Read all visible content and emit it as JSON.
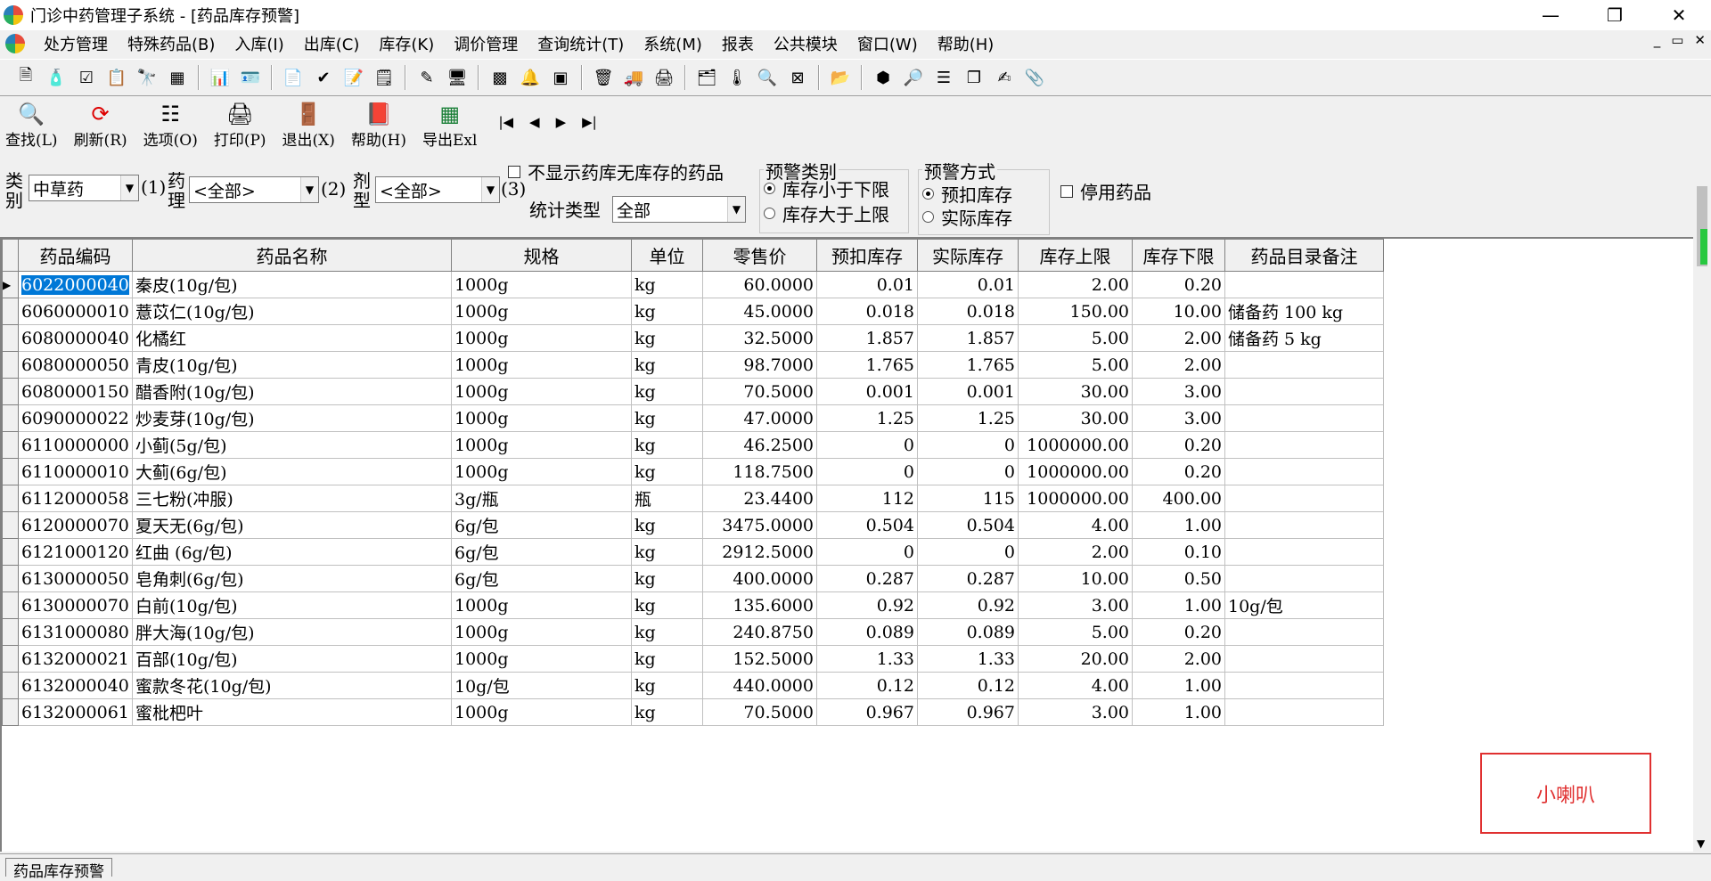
{
  "window": {
    "title": "门诊中药管理子系统 - [药品库存预警]",
    "controls": [
      "—",
      "❐",
      "✕"
    ]
  },
  "menu": [
    "处方管理",
    "特殊药品(B)",
    "入库(I)",
    "出库(C)",
    "库存(K)",
    "调价管理",
    "查询统计(T)",
    "系统(M)",
    "报表",
    "公共模块",
    "窗口(W)",
    "帮助(H)"
  ],
  "mdi_controls": [
    "_",
    "▭",
    "✕"
  ],
  "toolbar_icons": [
    "document-icon",
    "bottle-icon",
    "check-icon",
    "list-icon",
    "binoculars-icon",
    "database-icon",
    "chart-icon",
    "card-icon",
    "clipboard-icon",
    "checklist-icon",
    "edit-icon",
    "edit2-icon",
    "monitor-icon",
    "grid-icon",
    "bell-icon",
    "chip-icon",
    "bin-icon",
    "truck-icon",
    "print-icon",
    "folder-icon",
    "thermo-icon",
    "zoom-icon",
    "calc-icon",
    "open-folder-icon",
    "hexagon-icon",
    "search-icon",
    "table-icon",
    "windows-icon",
    "pen-icon",
    "clip-icon"
  ],
  "actions": {
    "find": "查找(L)",
    "refresh": "刷新(R)",
    "options": "选项(O)",
    "print": "打印(P)",
    "exit": "退出(X)",
    "help": "帮助(H)",
    "export": "导出Exl"
  },
  "nav": [
    "|◀",
    "◀",
    "▶",
    "▶|"
  ],
  "filters": {
    "category_label": "类别",
    "category_value": "中草药",
    "num1": "(1)",
    "pharm_label": "药理",
    "pharm_value": "<全部>",
    "num2": "(2)",
    "form_label": "剂型",
    "form_value": "<全部>",
    "num3": "(3)",
    "hide_empty": "不显示药库无库存的药品",
    "stat_type_label": "统计类型",
    "stat_type_value": "全部",
    "alert_type_title": "预警类别",
    "alert_type_opt1": "库存小于下限",
    "alert_type_opt2": "库存大于上限",
    "alert_mode_title": "预警方式",
    "alert_mode_opt1": "预扣库存",
    "alert_mode_opt2": "实际库存",
    "disabled_drug": "停用药品"
  },
  "table": {
    "headers": [
      "药品编码",
      "药品名称",
      "规格",
      "单位",
      "零售价",
      "预扣库存",
      "实际库存",
      "库存上限",
      "库存下限",
      "药品目录备注"
    ],
    "rows": [
      [
        "6022000040",
        "秦皮(10g/包)",
        "1000g",
        "kg",
        "60.0000",
        "0.01",
        "0.01",
        "2.00",
        "0.20",
        ""
      ],
      [
        "6060000010",
        "薏苡仁(10g/包)",
        "1000g",
        "kg",
        "45.0000",
        "0.018",
        "0.018",
        "150.00",
        "10.00",
        "储备药 100 kg"
      ],
      [
        "6080000040",
        "化橘红",
        "1000g",
        "kg",
        "32.5000",
        "1.857",
        "1.857",
        "5.00",
        "2.00",
        "储备药 5 kg"
      ],
      [
        "6080000050",
        "青皮(10g/包)",
        "1000g",
        "kg",
        "98.7000",
        "1.765",
        "1.765",
        "5.00",
        "2.00",
        ""
      ],
      [
        "6080000150",
        "醋香附(10g/包)",
        "1000g",
        "kg",
        "70.5000",
        "0.001",
        "0.001",
        "30.00",
        "3.00",
        ""
      ],
      [
        "6090000022",
        "炒麦芽(10g/包)",
        "1000g",
        "kg",
        "47.0000",
        "1.25",
        "1.25",
        "30.00",
        "3.00",
        ""
      ],
      [
        "6110000000",
        "小蓟(5g/包)",
        "1000g",
        "kg",
        "46.2500",
        "0",
        "0",
        "1000000.00",
        "0.20",
        ""
      ],
      [
        "6110000010",
        "大蓟(6g/包)",
        "1000g",
        "kg",
        "118.7500",
        "0",
        "0",
        "1000000.00",
        "0.20",
        ""
      ],
      [
        "6112000058",
        "三七粉(冲服)",
        "3g/瓶",
        "瓶",
        "23.4400",
        "112",
        "115",
        "1000000.00",
        "400.00",
        ""
      ],
      [
        "6120000070",
        "夏天无(6g/包)",
        "6g/包",
        "kg",
        "3475.0000",
        "0.504",
        "0.504",
        "4.00",
        "1.00",
        ""
      ],
      [
        "6121000120",
        "红曲 (6g/包)",
        "6g/包",
        "kg",
        "2912.5000",
        "0",
        "0",
        "2.00",
        "0.10",
        ""
      ],
      [
        "6130000050",
        "皂角刺(6g/包)",
        "6g/包",
        "kg",
        "400.0000",
        "0.287",
        "0.287",
        "10.00",
        "0.50",
        ""
      ],
      [
        "6130000070",
        "白前(10g/包)",
        "1000g",
        "kg",
        "135.6000",
        "0.92",
        "0.92",
        "3.00",
        "1.00",
        "10g/包"
      ],
      [
        "6131000080",
        "胖大海(10g/包)",
        "1000g",
        "kg",
        "240.8750",
        "0.089",
        "0.089",
        "5.00",
        "0.20",
        ""
      ],
      [
        "6132000021",
        "百部(10g/包)",
        "1000g",
        "kg",
        "152.5000",
        "1.33",
        "1.33",
        "20.00",
        "2.00",
        ""
      ],
      [
        "6132000040",
        "蜜款冬花(10g/包)",
        "10g/包",
        "kg",
        "440.0000",
        "0.12",
        "0.12",
        "4.00",
        "1.00",
        ""
      ],
      [
        "6132000061",
        "蜜枇杷叶",
        "1000g",
        "kg",
        "70.5000",
        "0.967",
        "0.967",
        "3.00",
        "1.00",
        ""
      ]
    ]
  },
  "speaker_label": "小喇叭",
  "status_tab": "药品库存预警",
  "colors": {
    "selection": "#0078d7",
    "speaker": "#e03030"
  }
}
